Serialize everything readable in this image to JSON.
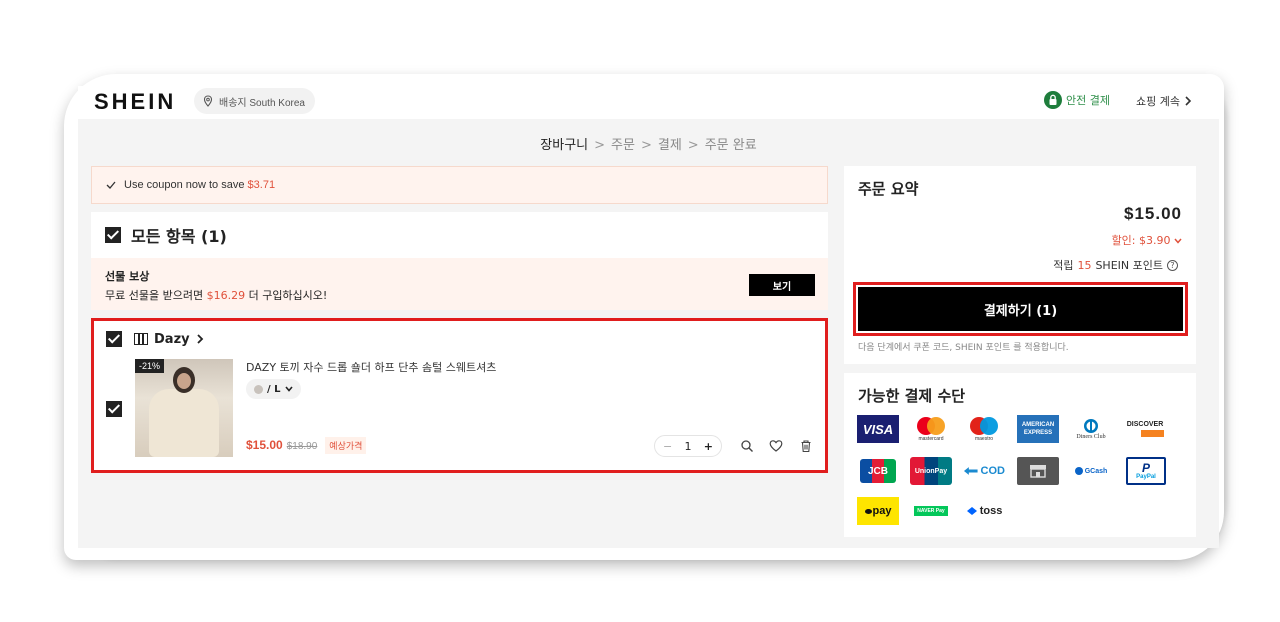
{
  "header": {
    "logo": "SHEIN",
    "shipping_label": "배송지 South Korea",
    "safe_payment": "안전 결제",
    "continue_shopping": "쇼핑 계속"
  },
  "breadcrumb": {
    "steps": [
      "장바구니",
      "주문",
      "결제",
      "주문 완료"
    ],
    "separator": ">"
  },
  "coupon_bar": {
    "text": "Use coupon now to save",
    "amount": "$3.71"
  },
  "cart": {
    "all_items_label": "모든 항목 (1)"
  },
  "gift": {
    "title": "선물 보상",
    "desc_prefix": "무료 선물을 받으려면",
    "amount": "$16.29",
    "desc_suffix": "더 구입하십시오!",
    "button": "보기"
  },
  "item": {
    "store_name": "Dazy",
    "discount_badge": "-21%",
    "name": "DAZY 토끼 자수 드롭 숄더 하프 단추 솜털 스웨트셔츠",
    "variant": "/ L",
    "price": "$15.00",
    "original_price": "$18.90",
    "price_tag": "예상가격",
    "quantity": "1"
  },
  "summary": {
    "title": "주문 요약",
    "total": "$15.00",
    "discount": "할인: $3.90",
    "points_prefix": "적립",
    "points_value": "15",
    "points_suffix": "SHEIN 포인트",
    "checkout_button": "결제하기 (1)",
    "note": "다음 단계에서 쿠폰 코드, SHEIN 포인트 를 적용합니다."
  },
  "payment": {
    "title": "가능한 결제 수단",
    "methods": [
      {
        "name": "VISA",
        "icon": "visa-icon"
      },
      {
        "name": "mastercard",
        "icon": "mastercard-icon"
      },
      {
        "name": "maestro",
        "icon": "maestro-icon"
      },
      {
        "name": "AMERICAN EXPRESS",
        "icon": "amex-icon"
      },
      {
        "name": "Diners Club",
        "icon": "diners-icon"
      },
      {
        "name": "DISCOVER",
        "icon": "discover-icon"
      },
      {
        "name": "JCB",
        "icon": "jcb-icon"
      },
      {
        "name": "UnionPay",
        "icon": "unionpay-icon"
      },
      {
        "name": "COD",
        "icon": "cod-icon"
      },
      {
        "name": "store",
        "icon": "store-icon"
      },
      {
        "name": "GCash",
        "icon": "gcash-icon"
      },
      {
        "name": "PayPal",
        "icon": "paypal-icon"
      },
      {
        "name": "pay",
        "icon": "kakaopay-icon"
      },
      {
        "name": "NAVER Pay",
        "icon": "naverpay-icon"
      },
      {
        "name": "toss",
        "icon": "toss-icon"
      }
    ]
  },
  "colors": {
    "accent_orange": "#e0513b",
    "highlight_red": "#e01e1e",
    "safe_green": "#1e7d3c",
    "checkout_black": "#000000"
  }
}
